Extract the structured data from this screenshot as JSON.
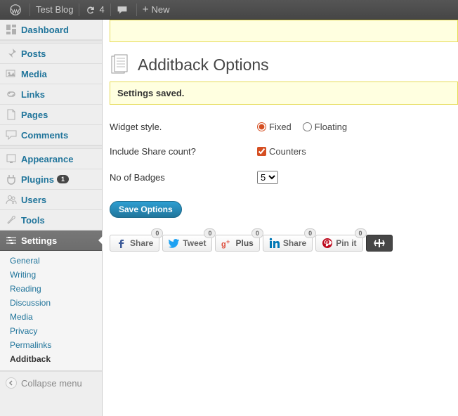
{
  "adminbar": {
    "site_name": "Test Blog",
    "updates_count": "4",
    "new_label": "New"
  },
  "sidebar": {
    "items": [
      {
        "id": "dashboard",
        "label": "Dashboard"
      },
      {
        "id": "posts",
        "label": "Posts"
      },
      {
        "id": "media",
        "label": "Media"
      },
      {
        "id": "links",
        "label": "Links"
      },
      {
        "id": "pages",
        "label": "Pages"
      },
      {
        "id": "comments",
        "label": "Comments"
      },
      {
        "id": "appearance",
        "label": "Appearance"
      },
      {
        "id": "plugins",
        "label": "Plugins",
        "badge": "1"
      },
      {
        "id": "users",
        "label": "Users"
      },
      {
        "id": "tools",
        "label": "Tools"
      },
      {
        "id": "settings",
        "label": "Settings"
      }
    ],
    "settings_submenu": [
      "General",
      "Writing",
      "Reading",
      "Discussion",
      "Media",
      "Privacy",
      "Permalinks",
      "Additback"
    ],
    "collapse_label": "Collapse menu"
  },
  "page": {
    "title": "Additback Options",
    "notice": "Settings saved.",
    "fields": {
      "widget_style_label": "Widget style.",
      "widget_style_options": {
        "fixed": "Fixed",
        "floating": "Floating"
      },
      "include_count_label": "Include Share count?",
      "counters_label": "Counters",
      "badges_label": "No of Badges",
      "badges_value": "5"
    },
    "save_button": "Save Options",
    "share_badges": [
      {
        "id": "fb",
        "label": "Share",
        "count": "0"
      },
      {
        "id": "tw",
        "label": "Tweet",
        "count": "0"
      },
      {
        "id": "gp",
        "label": "Plus",
        "count": "0"
      },
      {
        "id": "li",
        "label": "Share",
        "count": "0"
      },
      {
        "id": "pn",
        "label": "Pin it",
        "count": "0"
      }
    ]
  }
}
